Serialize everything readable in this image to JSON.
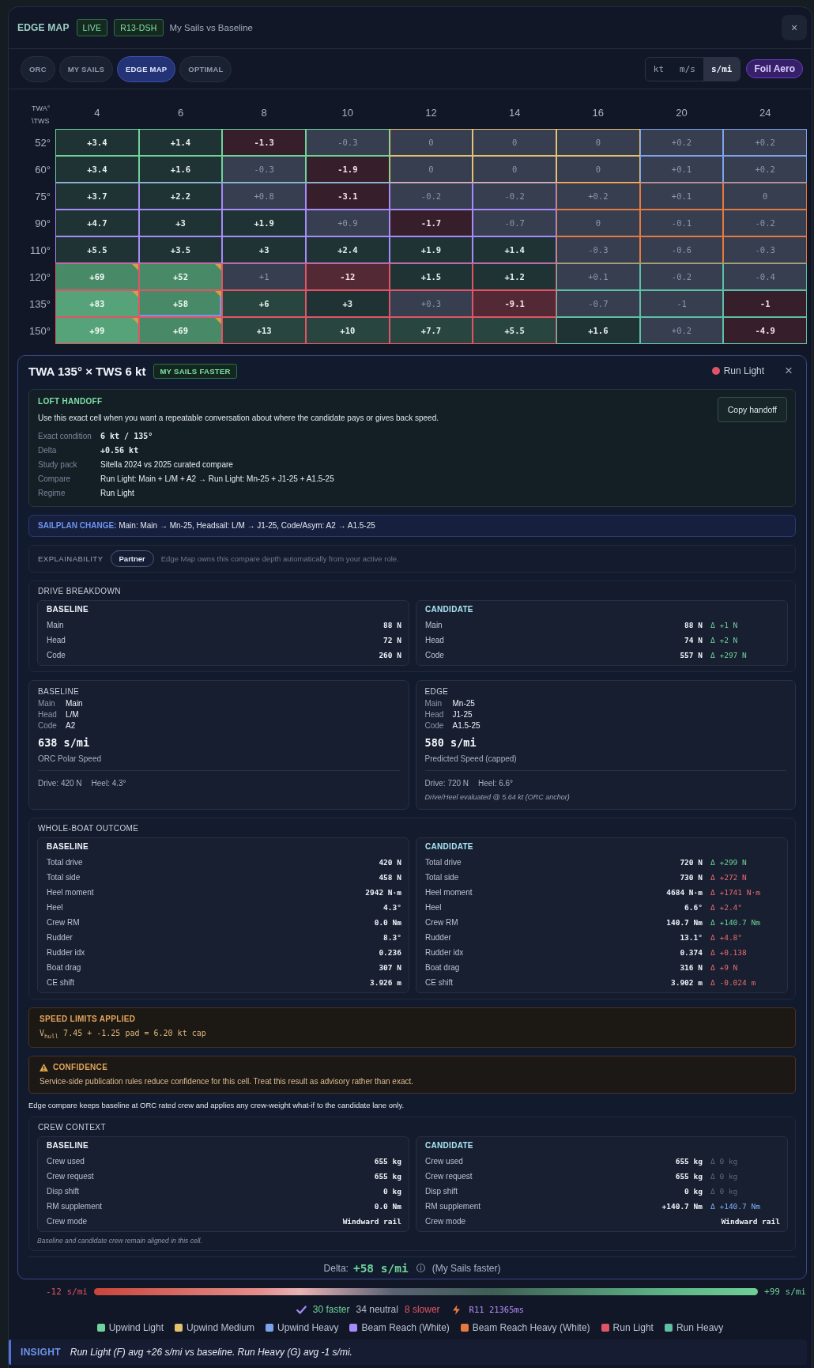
{
  "header": {
    "title": "EDGE MAP",
    "badges": [
      "LIVE",
      "R13-DSH"
    ],
    "subtitle": "My Sails vs Baseline",
    "close": "×"
  },
  "tabs": [
    {
      "label": "ORC",
      "selected": false
    },
    {
      "label": "MY SAILS",
      "selected": false
    },
    {
      "label": "EDGE MAP",
      "selected": true
    },
    {
      "label": "OPTIMAL",
      "selected": false
    }
  ],
  "units": [
    {
      "label": "kt",
      "selected": false
    },
    {
      "label": "m/s",
      "selected": false
    },
    {
      "label": "s/mi",
      "selected": true
    }
  ],
  "mode_badge": "Foil Aero",
  "grid": {
    "corner_label": "TWA° \\TWS",
    "columns": [
      "4",
      "6",
      "8",
      "10",
      "12",
      "14",
      "16",
      "20",
      "24"
    ],
    "rows": [
      {
        "label": "52°",
        "cells": [
          {
            "value": "+3.4",
            "kind": "gain1",
            "color": "#6fd39a",
            "flagged": false,
            "selected": false
          },
          {
            "value": "+1.4",
            "kind": "gain1",
            "color": "#6fd39a",
            "flagged": false,
            "selected": false
          },
          {
            "value": "-1.3",
            "kind": "loss1",
            "color": "#6fd39a",
            "flagged": false,
            "selected": false
          },
          {
            "value": "-0.3",
            "kind": "neutral",
            "color": "#6fd39a",
            "flagged": false,
            "selected": false
          },
          {
            "value": "0",
            "kind": "neutral",
            "color": "#e3c270",
            "flagged": false,
            "selected": false
          },
          {
            "value": "0",
            "kind": "neutral",
            "color": "#e3c270",
            "flagged": false,
            "selected": false
          },
          {
            "value": "0",
            "kind": "neutral",
            "color": "#e3c270",
            "flagged": false,
            "selected": false
          },
          {
            "value": "+0.2",
            "kind": "neutral",
            "color": "#7da3ea",
            "flagged": false,
            "selected": false
          },
          {
            "value": "+0.2",
            "kind": "neutral",
            "color": "#7da3ea",
            "flagged": false,
            "selected": false
          }
        ]
      },
      {
        "label": "60°",
        "cells": [
          {
            "value": "+3.4",
            "kind": "gain1",
            "color": "#6fd39a",
            "flagged": false,
            "selected": false
          },
          {
            "value": "+1.6",
            "kind": "gain1",
            "color": "#6fd39a",
            "flagged": false,
            "selected": false
          },
          {
            "value": "-0.3",
            "kind": "neutral",
            "color": "#6fd39a",
            "flagged": false,
            "selected": false
          },
          {
            "value": "-1.9",
            "kind": "loss1",
            "color": "#6fd39a",
            "flagged": false,
            "selected": false
          },
          {
            "value": "0",
            "kind": "neutral",
            "color": "#e3c270",
            "flagged": false,
            "selected": false
          },
          {
            "value": "0",
            "kind": "neutral",
            "color": "#e3c270",
            "flagged": false,
            "selected": false
          },
          {
            "value": "0",
            "kind": "neutral",
            "color": "#e3c270",
            "flagged": false,
            "selected": false
          },
          {
            "value": "+0.1",
            "kind": "neutral",
            "color": "#7da3ea",
            "flagged": false,
            "selected": false
          },
          {
            "value": "+0.2",
            "kind": "neutral",
            "color": "#7da3ea",
            "flagged": false,
            "selected": false
          }
        ]
      },
      {
        "label": "75°",
        "cells": [
          {
            "value": "+3.7",
            "kind": "gain1",
            "color": "#a78bfa",
            "flagged": false,
            "selected": false
          },
          {
            "value": "+2.2",
            "kind": "gain1",
            "color": "#a78bfa",
            "flagged": false,
            "selected": false
          },
          {
            "value": "+0.8",
            "kind": "neutral",
            "color": "#a78bfa",
            "flagged": false,
            "selected": false
          },
          {
            "value": "-3.1",
            "kind": "loss1",
            "color": "#a78bfa",
            "flagged": false,
            "selected": false
          },
          {
            "value": "-0.2",
            "kind": "neutral",
            "color": "#a78bfa",
            "flagged": false,
            "selected": false
          },
          {
            "value": "-0.2",
            "kind": "neutral",
            "color": "#a78bfa",
            "flagged": false,
            "selected": false
          },
          {
            "value": "+0.2",
            "kind": "neutral",
            "color": "#e5793f",
            "flagged": false,
            "selected": false
          },
          {
            "value": "+0.1",
            "kind": "neutral",
            "color": "#e5793f",
            "flagged": false,
            "selected": false
          },
          {
            "value": "0",
            "kind": "neutral",
            "color": "#e5793f",
            "flagged": false,
            "selected": false
          }
        ]
      },
      {
        "label": "90°",
        "cells": [
          {
            "value": "+4.7",
            "kind": "gain1",
            "color": "#a78bfa",
            "flagged": false,
            "selected": false
          },
          {
            "value": "+3",
            "kind": "gain1",
            "color": "#a78bfa",
            "flagged": false,
            "selected": false
          },
          {
            "value": "+1.9",
            "kind": "gain1",
            "color": "#a78bfa",
            "flagged": false,
            "selected": false
          },
          {
            "value": "+0.9",
            "kind": "neutral",
            "color": "#a78bfa",
            "flagged": false,
            "selected": false
          },
          {
            "value": "-1.7",
            "kind": "loss1",
            "color": "#a78bfa",
            "flagged": false,
            "selected": false
          },
          {
            "value": "-0.7",
            "kind": "neutral",
            "color": "#a78bfa",
            "flagged": false,
            "selected": false
          },
          {
            "value": "0",
            "kind": "neutral",
            "color": "#e5793f",
            "flagged": false,
            "selected": false
          },
          {
            "value": "-0.1",
            "kind": "neutral",
            "color": "#e5793f",
            "flagged": false,
            "selected": false
          },
          {
            "value": "-0.2",
            "kind": "neutral",
            "color": "#e5793f",
            "flagged": false,
            "selected": false
          }
        ]
      },
      {
        "label": "110°",
        "cells": [
          {
            "value": "+5.5",
            "kind": "gain1",
            "color": "#a78bfa",
            "flagged": false,
            "selected": false
          },
          {
            "value": "+3.5",
            "kind": "gain1",
            "color": "#a78bfa",
            "flagged": false,
            "selected": false
          },
          {
            "value": "+3",
            "kind": "gain1",
            "color": "#a78bfa",
            "flagged": false,
            "selected": false
          },
          {
            "value": "+2.4",
            "kind": "gain1",
            "color": "#a78bfa",
            "flagged": false,
            "selected": false
          },
          {
            "value": "+1.9",
            "kind": "gain1",
            "color": "#a78bfa",
            "flagged": false,
            "selected": false
          },
          {
            "value": "+1.4",
            "kind": "gain1",
            "color": "#a78bfa",
            "flagged": false,
            "selected": false
          },
          {
            "value": "-0.3",
            "kind": "neutral",
            "color": "#e5793f",
            "flagged": false,
            "selected": false
          },
          {
            "value": "-0.6",
            "kind": "neutral",
            "color": "#e5793f",
            "flagged": false,
            "selected": false
          },
          {
            "value": "-0.3",
            "kind": "neutral",
            "color": "#e5793f",
            "flagged": false,
            "selected": false
          }
        ]
      },
      {
        "label": "120°",
        "cells": [
          {
            "value": "+69",
            "kind": "gain3",
            "color": "#e05565",
            "flagged": true,
            "selected": false
          },
          {
            "value": "+52",
            "kind": "gain3",
            "color": "#e05565",
            "flagged": true,
            "selected": false
          },
          {
            "value": "+1",
            "kind": "neutral",
            "color": "#e05565",
            "flagged": false,
            "selected": false
          },
          {
            "value": "-12",
            "kind": "loss2",
            "color": "#e05565",
            "flagged": false,
            "selected": false
          },
          {
            "value": "+1.5",
            "kind": "gain1",
            "color": "#e05565",
            "flagged": false,
            "selected": false
          },
          {
            "value": "+1.2",
            "kind": "gain1",
            "color": "#e05565",
            "flagged": false,
            "selected": false
          },
          {
            "value": "+0.1",
            "kind": "neutral",
            "color": "#5fbfa4",
            "flagged": false,
            "selected": false
          },
          {
            "value": "-0.2",
            "kind": "neutral",
            "color": "#5fbfa4",
            "flagged": false,
            "selected": false
          },
          {
            "value": "-0.4",
            "kind": "neutral",
            "color": "#5fbfa4",
            "flagged": false,
            "selected": false
          }
        ]
      },
      {
        "label": "135°",
        "cells": [
          {
            "value": "+83",
            "kind": "gain4",
            "color": "#e05565",
            "flagged": true,
            "selected": false
          },
          {
            "value": "+58",
            "kind": "gain3",
            "color": "#e05565",
            "flagged": true,
            "selected": true
          },
          {
            "value": "+6",
            "kind": "gain2",
            "color": "#e05565",
            "flagged": false,
            "selected": false
          },
          {
            "value": "+3",
            "kind": "gain1",
            "color": "#e05565",
            "flagged": false,
            "selected": false
          },
          {
            "value": "+0.3",
            "kind": "neutral",
            "color": "#e05565",
            "flagged": false,
            "selected": false
          },
          {
            "value": "-9.1",
            "kind": "loss2",
            "color": "#e05565",
            "flagged": false,
            "selected": false
          },
          {
            "value": "-0.7",
            "kind": "neutral",
            "color": "#5fbfa4",
            "flagged": false,
            "selected": false
          },
          {
            "value": "-1",
            "kind": "neutral",
            "color": "#5fbfa4",
            "flagged": false,
            "selected": false
          },
          {
            "value": "-1",
            "kind": "loss1",
            "color": "#5fbfa4",
            "flagged": false,
            "selected": false
          }
        ]
      },
      {
        "label": "150°",
        "cells": [
          {
            "value": "+99",
            "kind": "gain4",
            "color": "#e05565",
            "flagged": true,
            "selected": false
          },
          {
            "value": "+69",
            "kind": "gain3",
            "color": "#e05565",
            "flagged": true,
            "selected": false
          },
          {
            "value": "+13",
            "kind": "gain2",
            "color": "#e05565",
            "flagged": false,
            "selected": false
          },
          {
            "value": "+10",
            "kind": "gain2",
            "color": "#e05565",
            "flagged": false,
            "selected": false
          },
          {
            "value": "+7.7",
            "kind": "gain2",
            "color": "#e05565",
            "flagged": false,
            "selected": false
          },
          {
            "value": "+5.5",
            "kind": "gain2",
            "color": "#e05565",
            "flagged": false,
            "selected": false
          },
          {
            "value": "+1.6",
            "kind": "gain1",
            "color": "#5fbfa4",
            "flagged": false,
            "selected": false
          },
          {
            "value": "+0.2",
            "kind": "neutral",
            "color": "#5fbfa4",
            "flagged": false,
            "selected": false
          },
          {
            "value": "-4.9",
            "kind": "loss1",
            "color": "#5fbfa4",
            "flagged": false,
            "selected": false
          }
        ]
      }
    ]
  },
  "detail": {
    "title": "TWA 135° × TWS 6 kt",
    "verdict": "MY SAILS FASTER",
    "regime": {
      "label": "Run Light",
      "color": "#e05565"
    },
    "close": "×",
    "handoff": {
      "title": "LOFT HANDOFF",
      "text": "Use this exact cell when you want a repeatable conversation about where the candidate pays or gives back speed.",
      "button": "Copy handoff",
      "fields": [
        {
          "label": "Exact condition",
          "value": "6 kt / 135°",
          "kind": "mono"
        },
        {
          "label": "Delta",
          "value": "+0.56 kt",
          "kind": "mono"
        },
        {
          "label": "Study pack",
          "value": "Sitella 2024 vs 2025 curated compare",
          "kind": "text"
        },
        {
          "label": "Compare",
          "value": "Run Light: Main + L/M + A2 → Run Light: Mn-25 + J1-25 + A1.5-25",
          "kind": "text"
        },
        {
          "label": "Regime",
          "value": "Run Light",
          "kind": "text"
        }
      ]
    },
    "sailplan": "**SAILPLAN CHANGE:** Main: Main → Mn-25, Headsail: L/M → J1-25, Code/Asym: A2 → A1.5-25",
    "explainability": {
      "label": "EXPLAINABILITY",
      "badge": "Partner",
      "text": "Edge Map owns this compare depth automatically from your active role."
    },
    "drive_breakdown": {
      "title": "DRIVE BREAKDOWN",
      "baseline": {
        "title": "BASELINE",
        "rows": [
          {
            "label": "Main",
            "value": "88 N"
          },
          {
            "label": "Head",
            "value": "72 N"
          },
          {
            "label": "Code",
            "value": "260 N"
          }
        ]
      },
      "candidate": {
        "title": "CANDIDATE",
        "rows": [
          {
            "label": "Main",
            "value": "88 N",
            "delta": "Δ +1 N",
            "kind": "gain"
          },
          {
            "label": "Head",
            "value": "74 N",
            "delta": "Δ +2 N",
            "kind": "gain"
          },
          {
            "label": "Code",
            "value": "557 N",
            "delta": "Δ +297 N",
            "kind": "gain"
          }
        ]
      }
    },
    "speed_cards": [
      {
        "title": "BASELINE",
        "sails": [
          {
            "label": "Main",
            "value": "Main"
          },
          {
            "label": "Head",
            "value": "L/M"
          },
          {
            "label": "Code",
            "value": "A2"
          }
        ],
        "speed": "638 s/mi",
        "caption": "ORC Polar Speed",
        "drive": "Drive: 420 N",
        "heel": "Heel: 4.3°"
      },
      {
        "title": "EDGE",
        "sails": [
          {
            "label": "Main",
            "value": "Mn-25"
          },
          {
            "label": "Head",
            "value": "J1-25"
          },
          {
            "label": "Code",
            "value": "A1.5-25"
          }
        ],
        "speed": "580 s/mi",
        "caption": "Predicted Speed (capped)",
        "drive": "Drive: 720 N",
        "heel": "Heel: 6.6°",
        "note": "Drive/Heel evaluated @ 5.64 kt (ORC anchor)"
      }
    ],
    "whole_boat": {
      "title": "WHOLE-BOAT OUTCOME",
      "baseline": {
        "title": "BASELINE",
        "rows": [
          {
            "label": "Total drive",
            "value": "420 N"
          },
          {
            "label": "Total side",
            "value": "458 N"
          },
          {
            "label": "Heel moment",
            "value": "2942 N·m"
          },
          {
            "label": "Heel",
            "value": "4.3°"
          },
          {
            "label": "Crew RM",
            "value": "0.0 Nm"
          },
          {
            "label": "Rudder",
            "value": "8.3°"
          },
          {
            "label": "Rudder idx",
            "value": "0.236"
          },
          {
            "label": "Boat drag",
            "value": "307 N"
          },
          {
            "label": "CE shift",
            "value": "3.926 m"
          }
        ]
      },
      "candidate": {
        "title": "CANDIDATE",
        "rows": [
          {
            "label": "Total drive",
            "value": "720 N",
            "delta": "Δ +299 N",
            "kind": "gain"
          },
          {
            "label": "Total side",
            "value": "730 N",
            "delta": "Δ +272 N",
            "kind": "loss"
          },
          {
            "label": "Heel moment",
            "value": "4684 N·m",
            "delta": "Δ +1741 N·m",
            "kind": "loss"
          },
          {
            "label": "Heel",
            "value": "6.6°",
            "delta": "Δ +2.4°",
            "kind": "loss"
          },
          {
            "label": "Crew RM",
            "value": "140.7 Nm",
            "delta": "Δ +140.7 Nm",
            "kind": "gain"
          },
          {
            "label": "Rudder",
            "value": "13.1°",
            "delta": "Δ +4.8°",
            "kind": "loss"
          },
          {
            "label": "Rudder idx",
            "value": "0.374",
            "delta": "Δ +0.138",
            "kind": "loss"
          },
          {
            "label": "Boat drag",
            "value": "316 N",
            "delta": "Δ +9 N",
            "kind": "loss"
          },
          {
            "label": "CE shift",
            "value": "3.902 m",
            "delta": "Δ -0.024 m",
            "kind": "loss"
          }
        ]
      }
    },
    "speed_limits": {
      "title": "SPEED LIMITS APPLIED",
      "formula": "V$_{hull}$ 7.45 + -1.25 pad = 6.20 kt cap"
    },
    "confidence": {
      "title": "CONFIDENCE",
      "text": "Service-side publication rules reduce confidence for this cell. Treat this result as advisory rather than exact."
    },
    "crew_note": "Edge compare keeps baseline at ORC rated crew and applies any crew-weight what-if to the candidate lane only.",
    "crew_context": {
      "title": "CREW CONTEXT",
      "baseline": {
        "title": "BASELINE",
        "rows": [
          {
            "label": "Crew used",
            "value": "655 kg"
          },
          {
            "label": "Crew request",
            "value": "655 kg"
          },
          {
            "label": "Disp shift",
            "value": "0 kg"
          },
          {
            "label": "RM supplement",
            "value": "0.0 Nm"
          },
          {
            "label": "Crew mode",
            "value": "Windward rail"
          }
        ]
      },
      "candidate": {
        "title": "CANDIDATE",
        "rows": [
          {
            "label": "Crew used",
            "value": "655 kg",
            "delta": "Δ 0 kg",
            "kind": "none"
          },
          {
            "label": "Crew request",
            "value": "655 kg",
            "delta": "Δ 0 kg",
            "kind": "none"
          },
          {
            "label": "Disp shift",
            "value": "0 kg",
            "delta": "Δ 0 kg",
            "kind": "none"
          },
          {
            "label": "RM supplement",
            "value": "+140.7 Nm",
            "delta": "Δ +140.7 Nm",
            "kind": "info"
          },
          {
            "label": "Crew mode",
            "value": "Windward rail"
          }
        ]
      },
      "footnote": "Baseline and candidate crew remain aligned in this cell."
    },
    "delta": {
      "label": "Delta:",
      "value": "+58 s/mi",
      "verdict": "(My Sails faster)"
    }
  },
  "scale": {
    "min": "-12 s/mi",
    "max": "+99 s/mi"
  },
  "stats": {
    "faster": "30 faster",
    "neutral": "34 neutral",
    "slower": "8 slower",
    "run": "R11 21365ms"
  },
  "legend": [
    {
      "label": "Upwind Light",
      "color": "#6fd39a"
    },
    {
      "label": "Upwind Medium",
      "color": "#e3c270"
    },
    {
      "label": "Upwind Heavy",
      "color": "#7da3ea"
    },
    {
      "label": "Beam Reach (White)",
      "color": "#a78bfa"
    },
    {
      "label": "Beam Reach Heavy (White)",
      "color": "#e5793f"
    },
    {
      "label": "Run Light",
      "color": "#e05565"
    },
    {
      "label": "Run Heavy",
      "color": "#5fbfa4"
    }
  ],
  "insight": {
    "label": "INSIGHT",
    "text": "Run Light (F) avg +26 s/mi vs baseline. Run Heavy (G) avg -1 s/mi."
  }
}
